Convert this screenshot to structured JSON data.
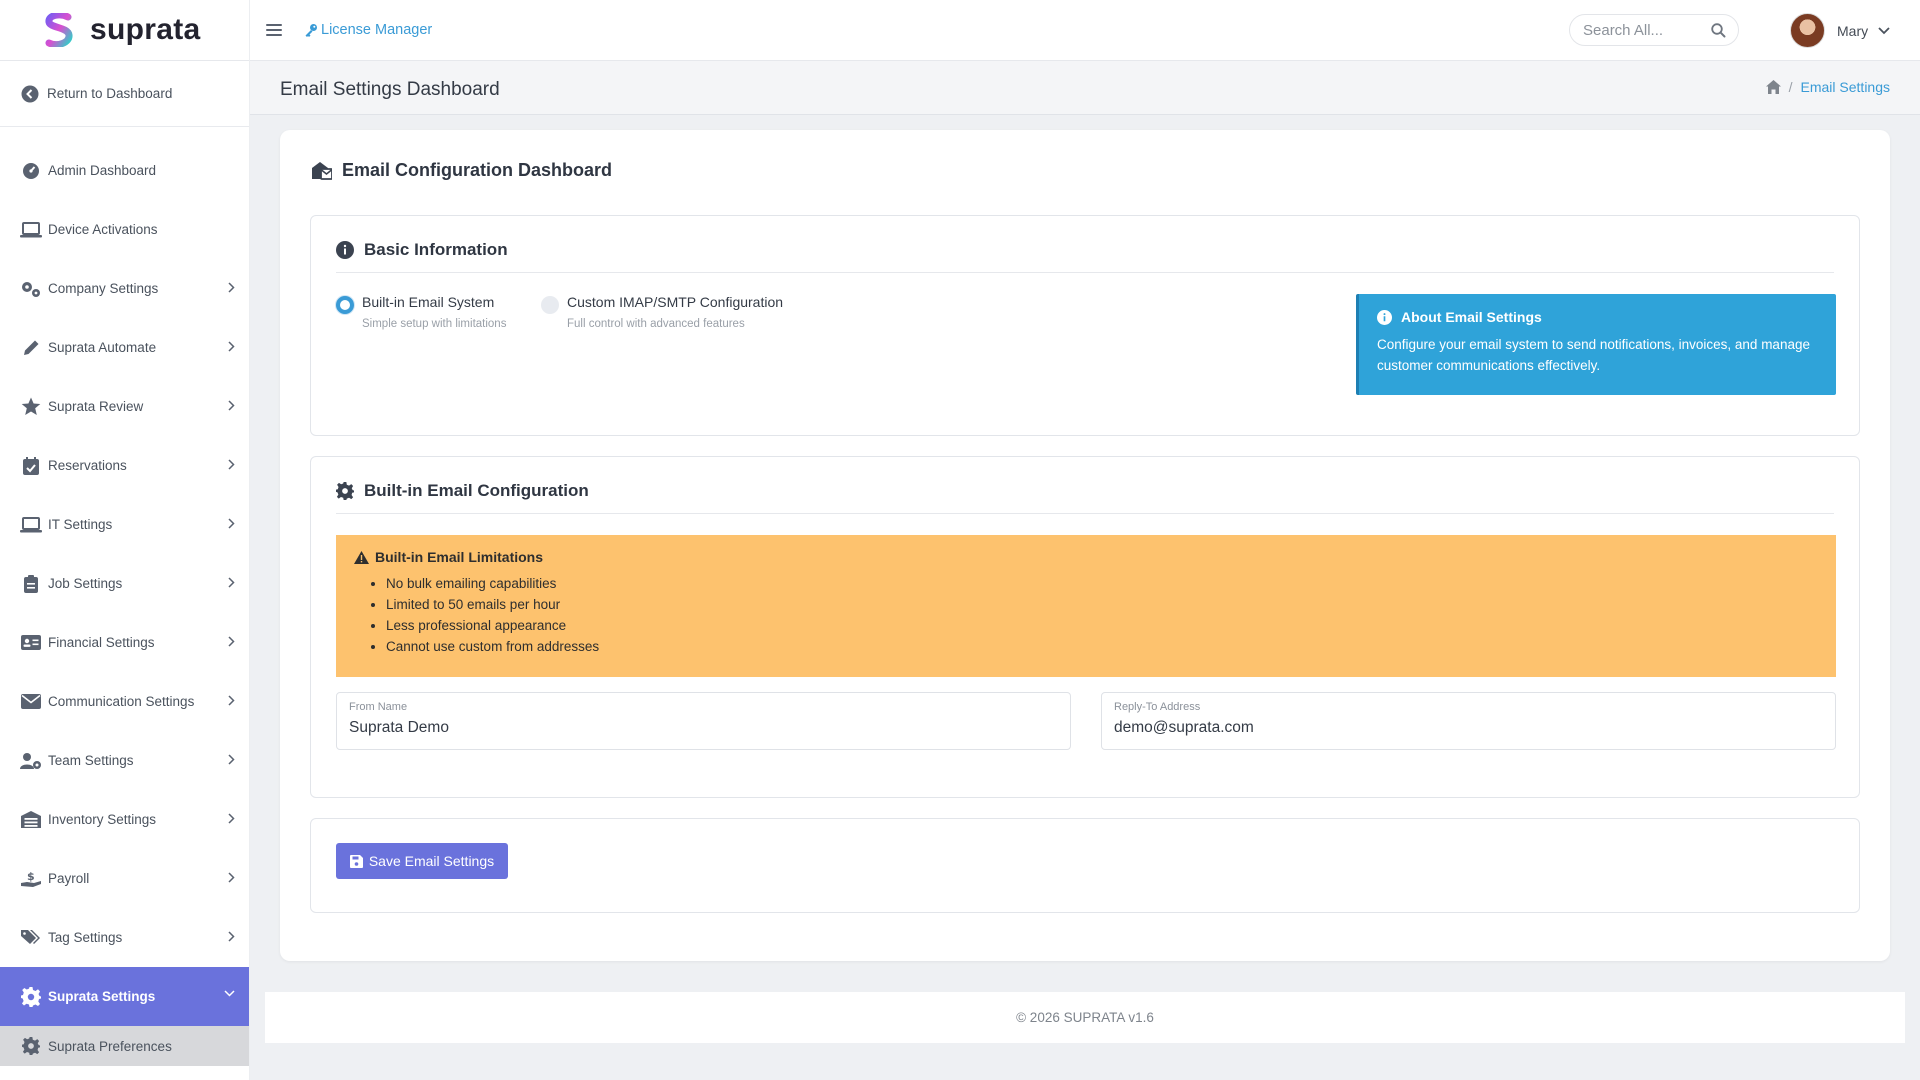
{
  "brand": {
    "name": "suprata",
    "logo_icon": "suprata-logo-icon"
  },
  "header": {
    "menu_icon": "hamburger-icon",
    "license_link": "License Manager",
    "search_placeholder": "Search All...",
    "user_name": "Mary"
  },
  "sidebar": {
    "return_label": "Return to Dashboard",
    "items": [
      {
        "label": "Admin Dashboard",
        "icon": "gauge-icon",
        "chevron": false
      },
      {
        "label": "Device Activations",
        "icon": "laptop-icon",
        "chevron": false
      },
      {
        "label": "Company Settings",
        "icon": "cogs-icon",
        "chevron": true
      },
      {
        "label": "Suprata Automate",
        "icon": "pencil-icon",
        "chevron": true
      },
      {
        "label": "Suprata Review",
        "icon": "star-icon",
        "chevron": true
      },
      {
        "label": "Reservations",
        "icon": "calendar-check-icon",
        "chevron": true
      },
      {
        "label": "IT Settings",
        "icon": "laptop-icon",
        "chevron": true
      },
      {
        "label": "Job Settings",
        "icon": "clipboard-icon",
        "chevron": true
      },
      {
        "label": "Financial Settings",
        "icon": "id-card-icon",
        "chevron": true
      },
      {
        "label": "Communication Settings",
        "icon": "envelope-icon",
        "chevron": true
      },
      {
        "label": "Team Settings",
        "icon": "user-cog-icon",
        "chevron": true
      },
      {
        "label": "Inventory Settings",
        "icon": "warehouse-icon",
        "chevron": true
      },
      {
        "label": "Payroll",
        "icon": "hand-dollar-icon",
        "chevron": true
      },
      {
        "label": "Tag Settings",
        "icon": "tags-icon",
        "chevron": true
      },
      {
        "label": "Suprata Settings",
        "icon": "gear-icon",
        "chevron": true,
        "active": true
      }
    ],
    "sub_item": "Suprata Preferences"
  },
  "page": {
    "title": "Email Settings Dashboard",
    "breadcrumb_current": "Email Settings"
  },
  "card": {
    "title": "Email Configuration Dashboard",
    "basic": {
      "heading": "Basic Information",
      "options": [
        {
          "label": "Built-in Email System",
          "hint": "Simple setup with limitations",
          "selected": true
        },
        {
          "label": "Custom IMAP/SMTP Configuration",
          "hint": "Full control with advanced features",
          "selected": false
        }
      ],
      "info_title": "About Email Settings",
      "info_body": "Configure your email system to send notifications, invoices, and manage customer communications effectively."
    },
    "builtin": {
      "heading": "Built-in Email Configuration",
      "warning_title": "Built-in Email Limitations",
      "limitations": [
        "No bulk emailing capabilities",
        "Limited to 50 emails per hour",
        "Less professional appearance",
        "Cannot use custom from addresses"
      ],
      "from_name_label": "From Name",
      "from_name_value": "Suprata Demo",
      "reply_to_label": "Reply-To Address",
      "reply_to_value": "demo@suprata.com"
    },
    "save_label": "Save Email Settings"
  },
  "footer": {
    "text": "© 2026 SUPRATA v1.6"
  },
  "colors": {
    "accent": "#6a72dc",
    "link": "#3a9bd6",
    "info": "#2fa3d9",
    "warning": "#fdc26e"
  }
}
